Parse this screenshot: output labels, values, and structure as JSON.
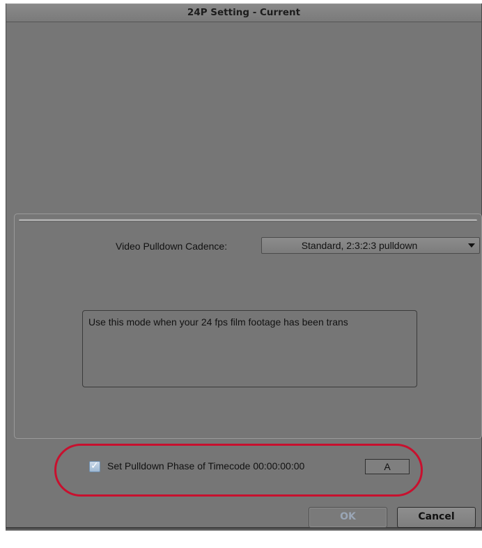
{
  "window": {
    "title": "24P Setting - Current"
  },
  "cadence": {
    "label": "Video Pulldown Cadence:",
    "selected": "Standard, 2:3:2:3 pulldown"
  },
  "description": {
    "text": "Use this mode when your 24 fps film footage has been trans"
  },
  "timecode": {
    "checked": true,
    "label": "Set Pulldown Phase of Timecode 00:00:00:00",
    "phase_value": "A"
  },
  "buttons": {
    "ok_label": "OK",
    "cancel_label": "Cancel"
  },
  "colors": {
    "dialog_background": "#767676",
    "highlight_ring": "#c8102e",
    "checkbox_fill": "#9fb9d3"
  },
  "icons": {
    "checkbox": "check-icon",
    "dropdown": "triangle-down-icon"
  }
}
